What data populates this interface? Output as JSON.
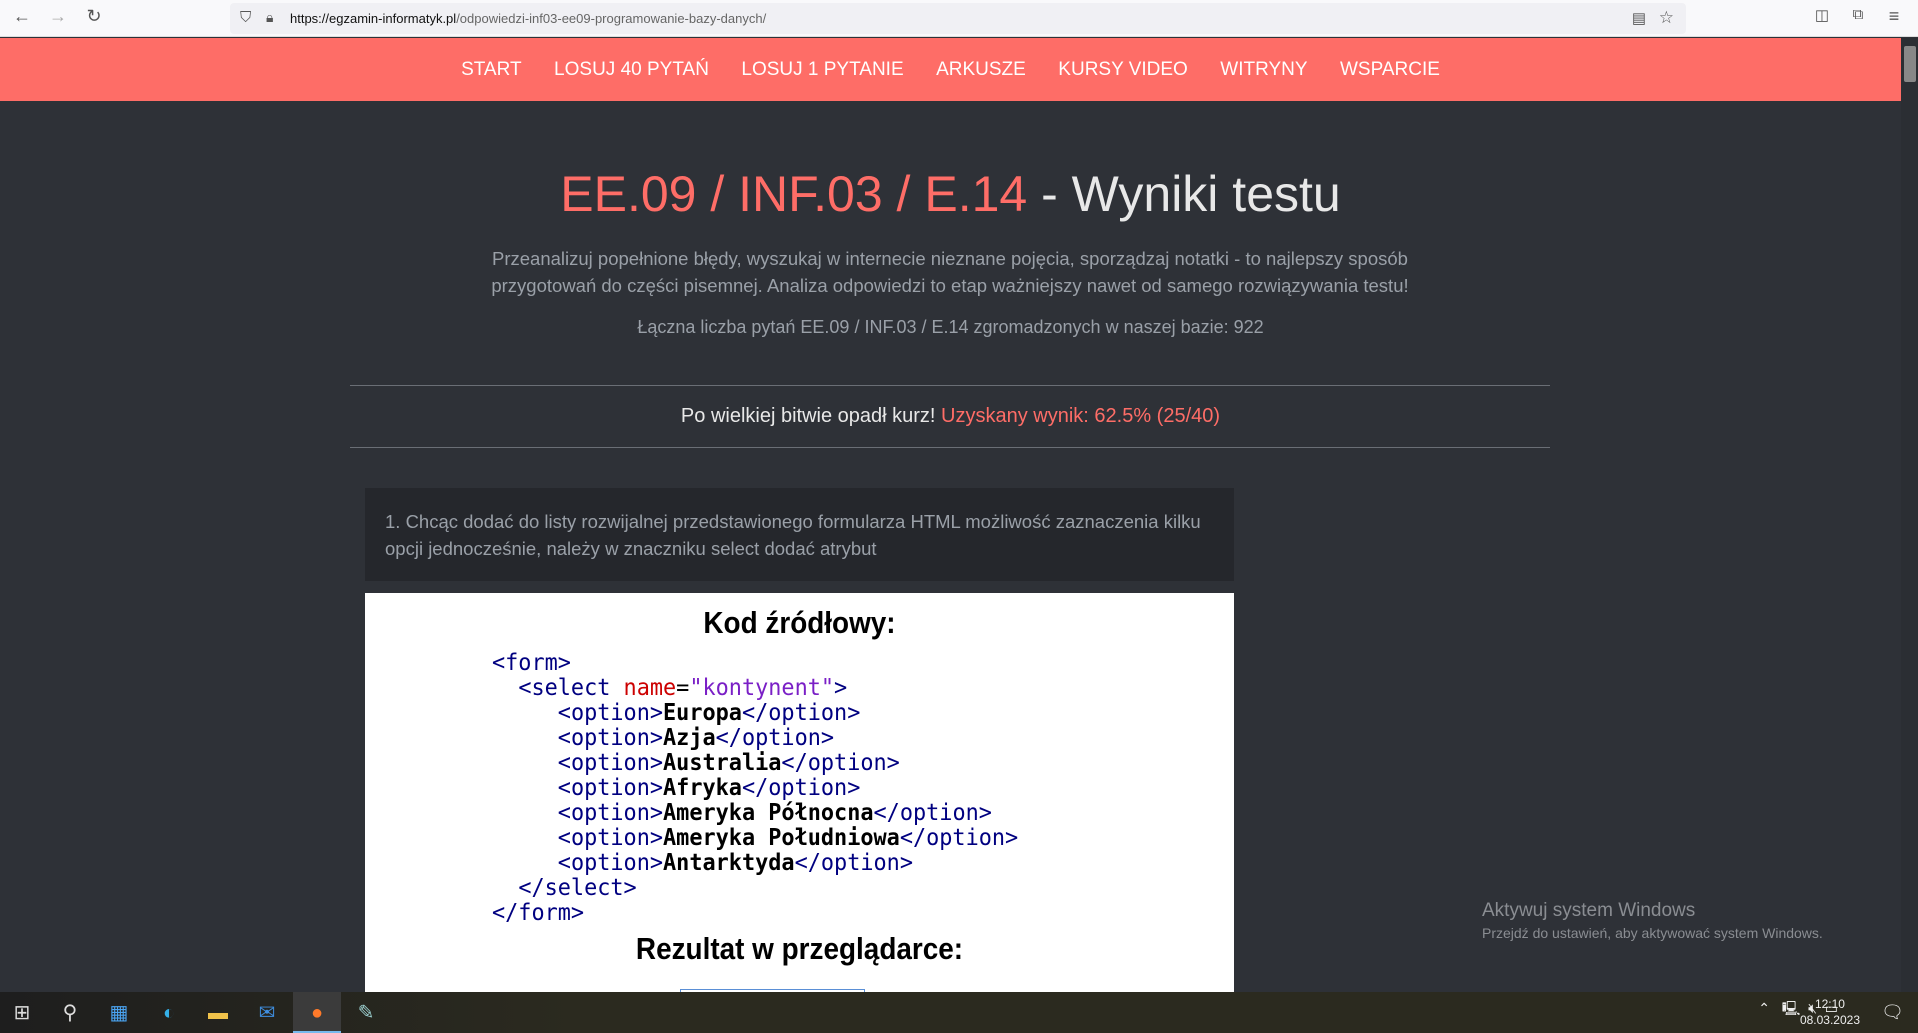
{
  "browser": {
    "url_domain": "https://egzamin-informatyk.pl",
    "url_path": "/odpowiedzi-inf03-ee09-programowanie-bazy-danych/"
  },
  "nav": {
    "items": [
      "START",
      "LOSUJ 40 PYTAŃ",
      "LOSUJ 1 PYTANIE",
      "ARKUSZE",
      "KURSY VIDEO",
      "WITRYNY",
      "WSPARCIE"
    ]
  },
  "page": {
    "title_accent": "EE.09 / INF.03 / E.14",
    "title_rest": " - Wyniki testu",
    "intro": "Przeanalizuj popełnione błędy, wyszukaj w internecie nieznane pojęcia, sporządzaj notatki - to najlepszy sposób przygotowań do części pisemnej. Analiza odpowiedzi to etap ważniejszy nawet od samego rozwiązywania testu!",
    "count": "Łączna liczba pytań EE.09 / INF.03 / E.14 zgromadzonych w naszej bazie: 922",
    "result_text": "Po wielkiej bitwie opadł kurz! ",
    "result_score": "Uzyskany wynik: 62.5% (25/40)"
  },
  "question": {
    "text": "1. Chcąc dodać do listy rozwijalnej przedstawionego formularza HTML możliwość zaznaczenia kilku opcji jednocześnie, należy w znaczniku select dodać atrybut",
    "image": {
      "heading1": "Kod źródłowy:",
      "heading2": "Rezultat w przeglądarce:",
      "form_open": "<form>",
      "select_open": "<select ",
      "attr": "name",
      "eq": "=",
      "val": "\"kontynent\"",
      "gt": ">",
      "options": [
        "Europa",
        "Azja",
        "Australia",
        "Afryka",
        "Ameryka Północna",
        "Ameryka Południowa",
        "Antarktyda"
      ],
      "opt_open": "<option>",
      "opt_close": "</option>",
      "select_close": "</select>",
      "form_close": "</form>"
    }
  },
  "watermark": {
    "line1": "Aktywuj system Windows",
    "line2": "Przejdź do ustawień, aby aktywować system Windows."
  },
  "taskbar": {
    "time": "12:10",
    "date": "08.03.2023"
  }
}
